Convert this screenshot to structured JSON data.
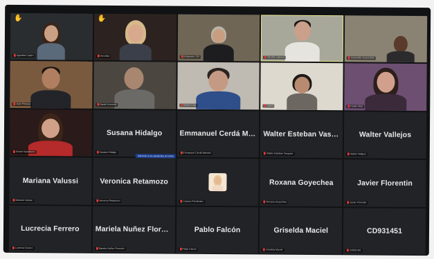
{
  "participants": [
    {
      "display_name": "",
      "tag": "Agustina Castro",
      "raised_hand": true,
      "video": true
    },
    {
      "display_name": "",
      "tag": "Veronika",
      "raised_hand": true,
      "video": true
    },
    {
      "display_name": "",
      "tag": "Intérprete LSA",
      "raised_hand": false,
      "video": true
    },
    {
      "display_name": "",
      "tag": "Nicolás Cabrera",
      "raised_hand": false,
      "video": true
    },
    {
      "display_name": "",
      "tag": "Sebastián Insaurralde",
      "raised_hand": false,
      "video": true
    },
    {
      "display_name": "",
      "tag": "Juan Pereyra",
      "raised_hand": false,
      "video": true
    },
    {
      "display_name": "",
      "tag": "Daniel Acevedo",
      "raised_hand": false,
      "video": true
    },
    {
      "display_name": "",
      "tag": "Gisela Trejo",
      "raised_hand": false,
      "video": true
    },
    {
      "display_name": "",
      "tag": "Laura",
      "raised_hand": false,
      "video": true
    },
    {
      "display_name": "",
      "tag": "Paola Vidal",
      "raised_hand": false,
      "video": true
    },
    {
      "display_name": "",
      "tag": "Gisela Salvatierra",
      "raised_hand": false,
      "video": true
    },
    {
      "display_name": "Susana Hidalgo",
      "tag": "Susana Hidalgo",
      "raised_hand": false,
      "video": false
    },
    {
      "display_name": "Emmanuel Cerdá Mend...",
      "tag": "Emmanuel Cerdá Mendez",
      "raised_hand": false,
      "video": false
    },
    {
      "display_name": "Walter Esteban Vasquez",
      "tag": "Walter Esteban Vasquez",
      "raised_hand": false,
      "video": false
    },
    {
      "display_name": "Walter Vallejos",
      "tag": "Walter Vallejos",
      "raised_hand": false,
      "video": false
    },
    {
      "display_name": "Mariana Valussi",
      "tag": "Mariana Valussi",
      "raised_hand": false,
      "video": false
    },
    {
      "display_name": "Veronica Retamozo",
      "tag": "Veronica Retamozo",
      "raised_hand": false,
      "video": false
    },
    {
      "display_name": "",
      "tag": "Luciana Fernández",
      "raised_hand": false,
      "video": false,
      "avatar": true
    },
    {
      "display_name": "Roxana Goyechea",
      "tag": "Roxana Goyechea",
      "raised_hand": false,
      "video": false
    },
    {
      "display_name": "Javier Florentin",
      "tag": "Javier Florentin",
      "raised_hand": false,
      "video": false
    },
    {
      "display_name": "Lucrecia Ferrero",
      "tag": "Lucrecia Ferrero",
      "raised_hand": false,
      "video": false
    },
    {
      "display_name": "Mariela Nuñez Florentin",
      "tag": "Mariela Nuñez Florentin",
      "raised_hand": false,
      "video": false
    },
    {
      "display_name": "Pablo Falcón",
      "tag": "Pablo Falcón",
      "raised_hand": false,
      "video": false
    },
    {
      "display_name": "Griselda Maciel",
      "tag": "Griselda Maciel",
      "raised_hand": false,
      "video": false
    },
    {
      "display_name": "CD931451",
      "tag": "CD931451",
      "raised_hand": false,
      "video": false
    }
  ],
  "tooltip": {
    "text": "Silenciar a los asistentes al entrar"
  },
  "colors": {
    "meeting_bg": "#111214",
    "tile_bg": "#222326",
    "name_text": "#e8e8ea",
    "muted_red": "#e03b3b",
    "raised_hand": "#f5c531",
    "speaker_outline": "#e3e58a"
  }
}
